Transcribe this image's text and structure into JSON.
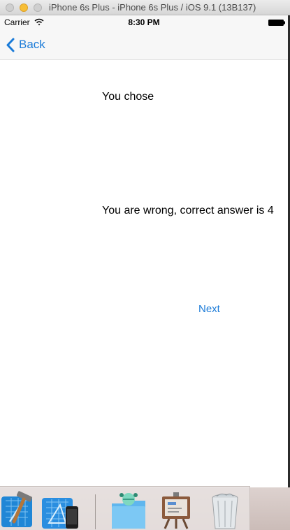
{
  "window": {
    "title": "iPhone 6s Plus - iPhone 6s Plus / iOS 9.1 (13B137)",
    "buttons": [
      "close",
      "minimize",
      "zoom"
    ]
  },
  "status_bar": {
    "carrier": "Carrier",
    "time": "8:30 PM",
    "icons": [
      "wifi-icon",
      "battery-icon"
    ]
  },
  "nav_bar": {
    "back_label": "Back",
    "back_icon": "chevron-left-icon"
  },
  "content": {
    "chosen_label": "You chose",
    "result_label": "You are wrong, correct answer is 4",
    "next_label": "Next"
  },
  "dock": {
    "items": [
      {
        "icon": "xcode-icon"
      },
      {
        "icon": "simulator-icon"
      },
      {
        "icon": "downloads-folder-icon"
      },
      {
        "icon": "keynote-icon"
      },
      {
        "icon": "trash-icon"
      }
    ]
  },
  "colors": {
    "accent": "#1b7bd8",
    "bar_background": "#f7f7f7",
    "background": "#ffffff"
  }
}
